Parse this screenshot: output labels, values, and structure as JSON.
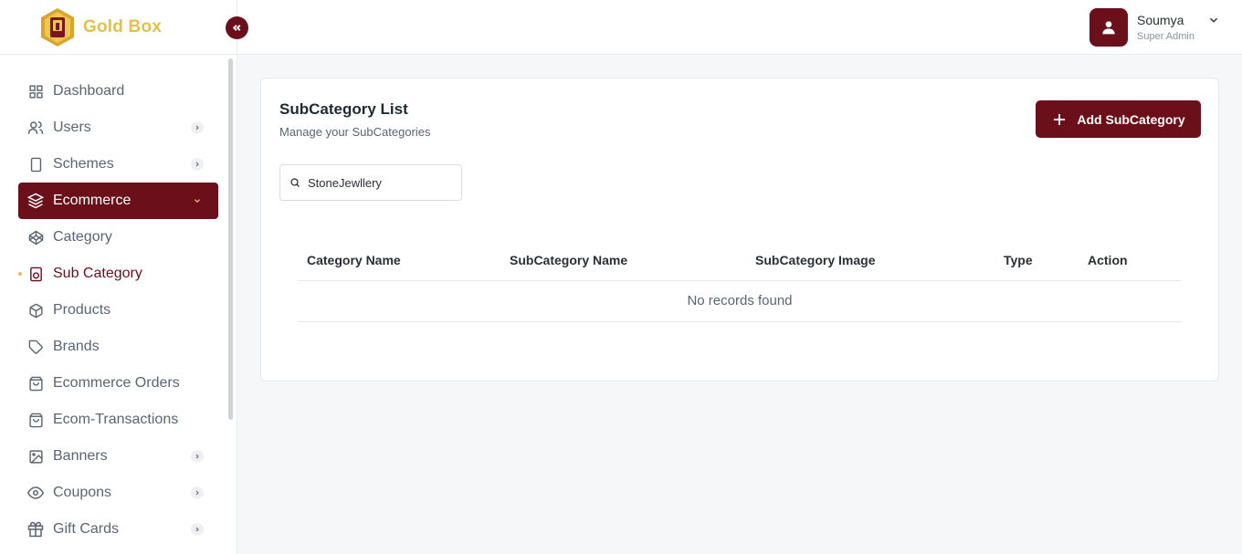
{
  "brand": {
    "name": "Gold Box",
    "logo_icon": "gold-box-logo"
  },
  "colors": {
    "primary": "#6b0f1a",
    "gold": "#e3c04a",
    "muted": "#5b6472"
  },
  "header": {
    "user": {
      "name": "Soumya",
      "role": "Super Admin",
      "avatar_icon": "user-icon"
    }
  },
  "sidebar": {
    "items": [
      {
        "label": "Dashboard",
        "icon": "grid-icon"
      },
      {
        "label": "Users",
        "icon": "users-icon",
        "has_submenu": true
      },
      {
        "label": "Schemes",
        "icon": "tablet-icon",
        "has_submenu": true
      },
      {
        "label": "Ecommerce",
        "icon": "layers-icon",
        "active": true,
        "expanded": true
      },
      {
        "label": "Category",
        "icon": "codepen-icon"
      },
      {
        "label": "Sub Category",
        "icon": "speaker-icon",
        "current": true
      },
      {
        "label": "Products",
        "icon": "box-icon"
      },
      {
        "label": "Brands",
        "icon": "tag-icon"
      },
      {
        "label": "Ecommerce Orders",
        "icon": "shopping-bag-icon"
      },
      {
        "label": "Ecom-Transactions",
        "icon": "shopping-bag-icon"
      },
      {
        "label": "Banners",
        "icon": "image-icon",
        "has_submenu": true
      },
      {
        "label": "Coupons",
        "icon": "eye-icon",
        "has_submenu": true
      },
      {
        "label": "Gift Cards",
        "icon": "gift-icon",
        "has_submenu": true
      }
    ]
  },
  "main": {
    "title": "SubCategory List",
    "subtitle": "Manage your SubCategories",
    "add_button": "Add SubCategory",
    "search": {
      "value": "StoneJewllery",
      "placeholder": "Search"
    },
    "table": {
      "columns": [
        "Category Name",
        "SubCategory Name",
        "SubCategory Image",
        "Type",
        "Action"
      ],
      "empty_text": "No records found"
    }
  }
}
